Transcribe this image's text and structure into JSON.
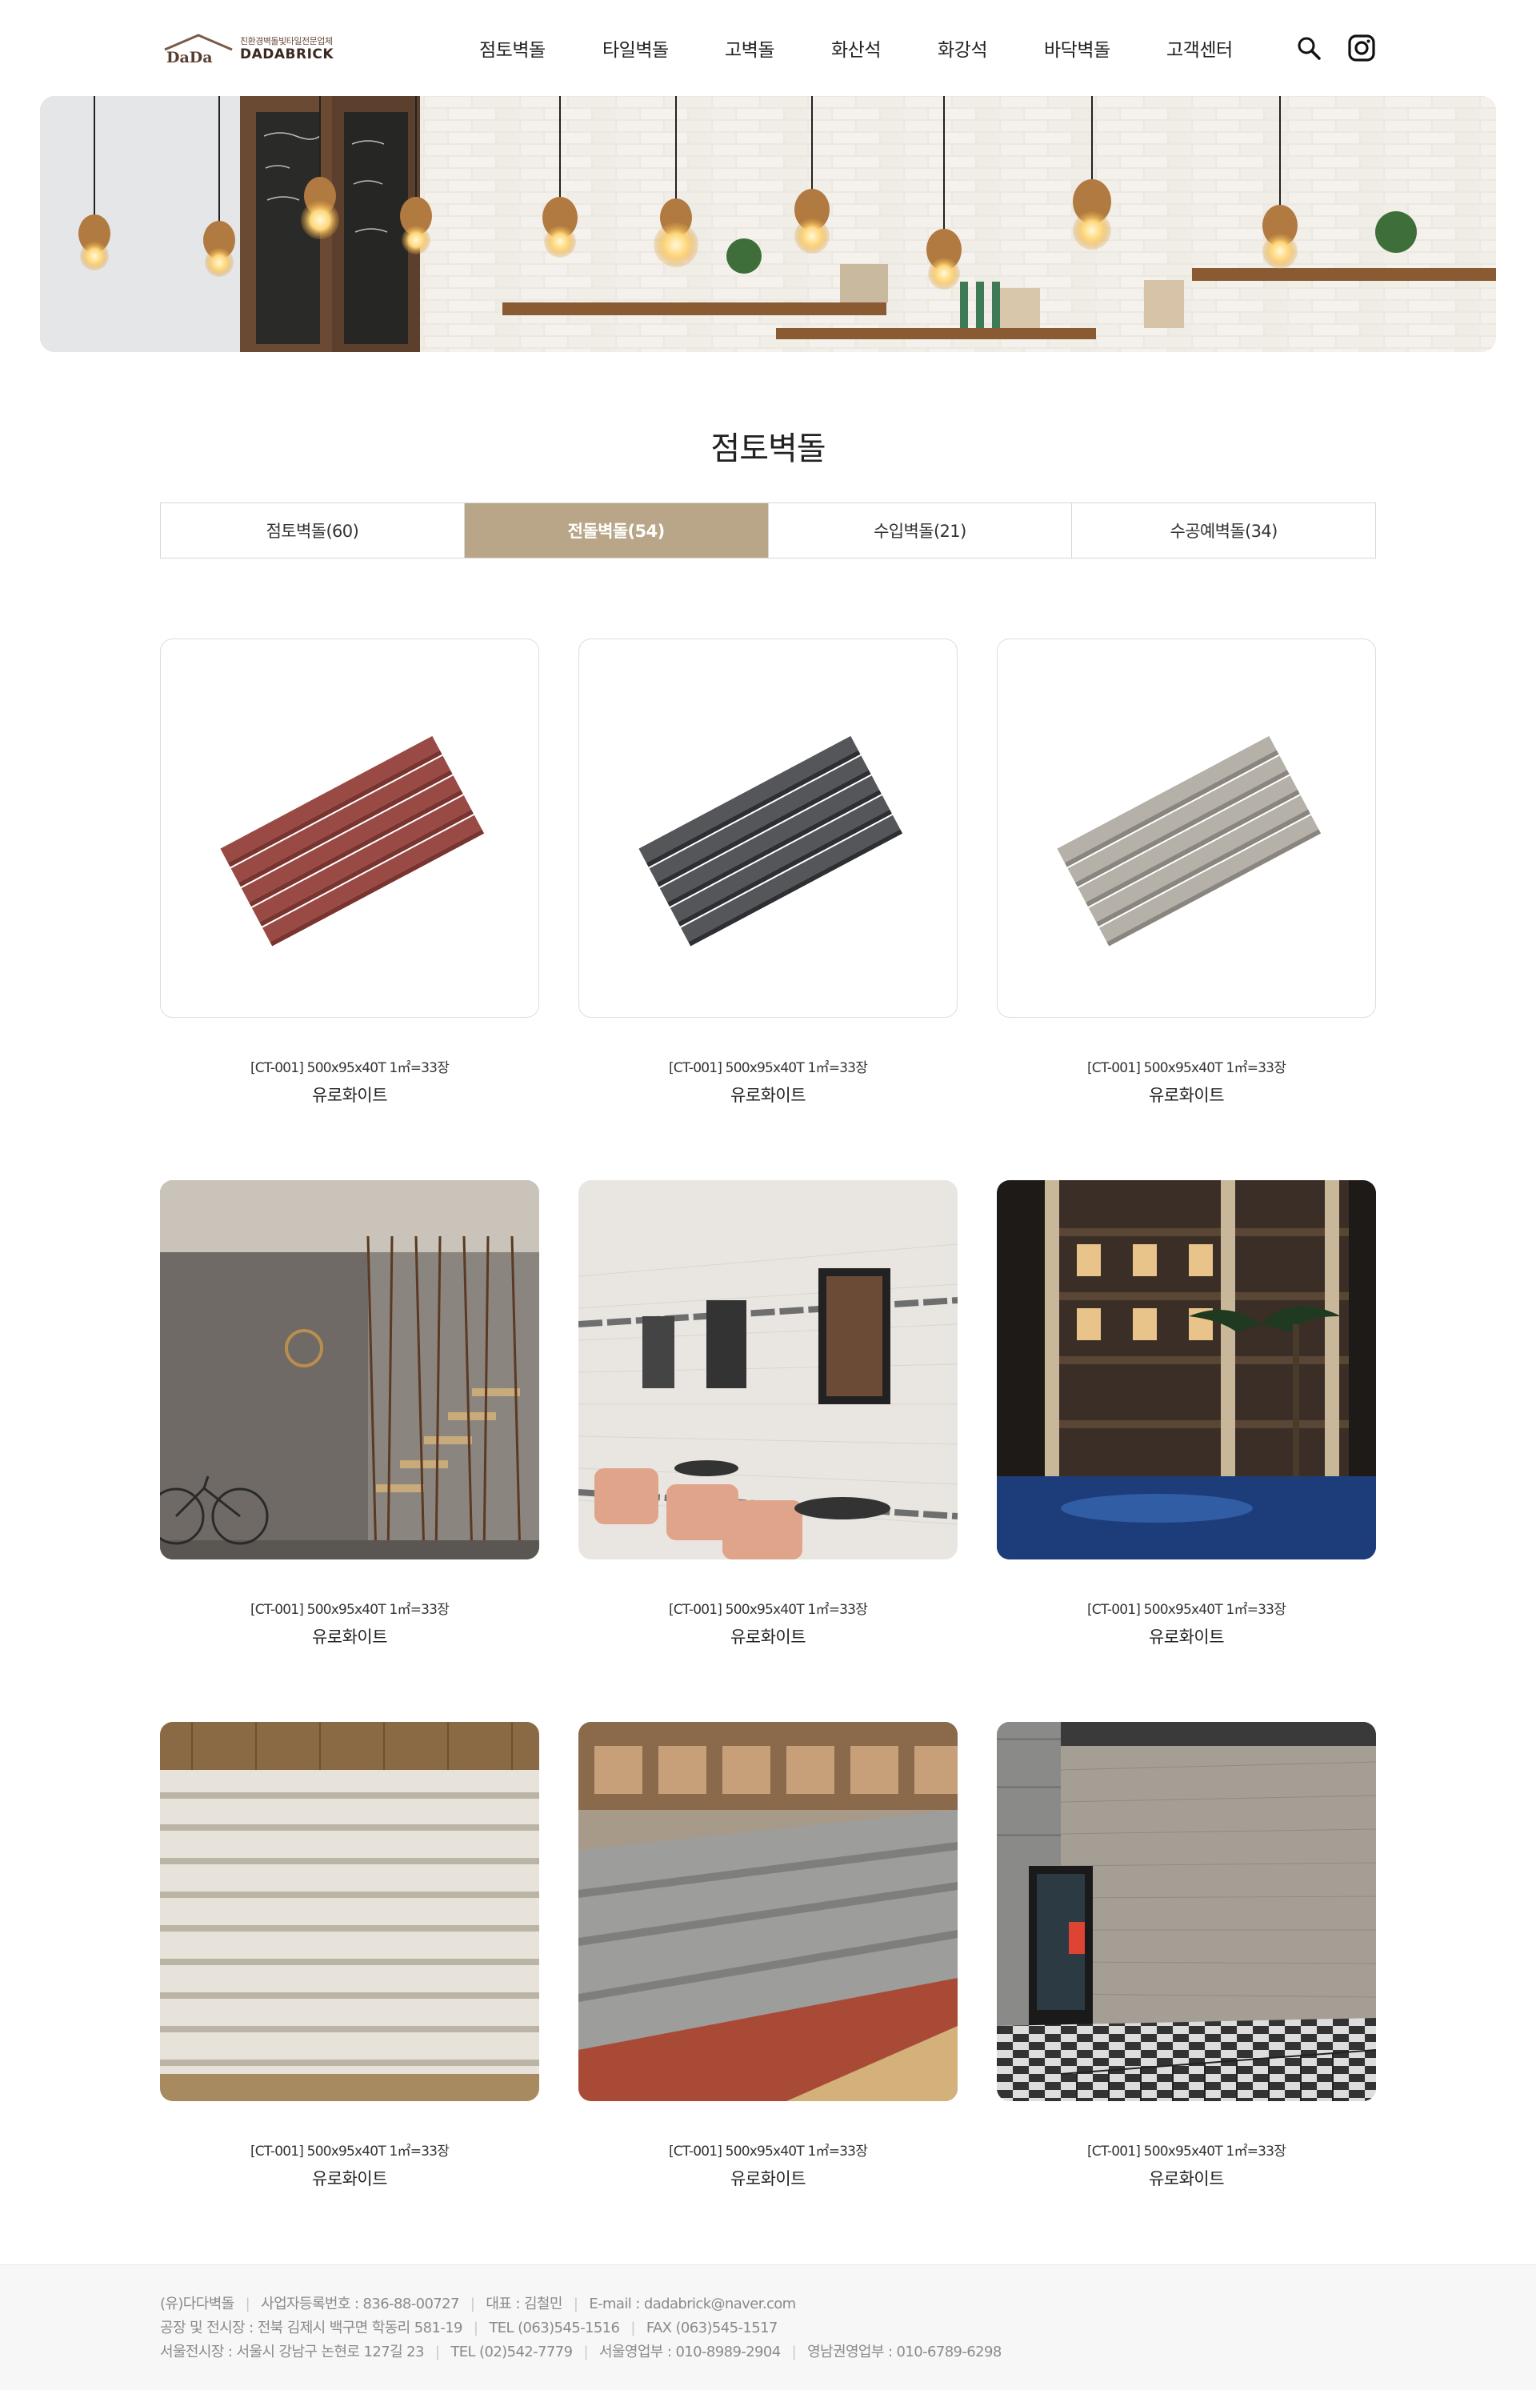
{
  "header": {
    "logo_mark": "DaDa",
    "logo_sub": "친환경벽돌빛타일전문업체",
    "logo_main": "DADABRICK",
    "nav": [
      "점토벽돌",
      "타일벽돌",
      "고벽돌",
      "화산석",
      "화강석",
      "바닥벽돌",
      "고객센터"
    ],
    "icons": [
      "search-icon",
      "instagram-icon"
    ]
  },
  "hero": {
    "icon": "cafe-interior-photo"
  },
  "section": {
    "title": "점토벽돌"
  },
  "tabs": [
    {
      "label": "점토벽돌(60)",
      "active": false
    },
    {
      "label": "전돌벽돌(54)",
      "active": true
    },
    {
      "label": "수입벽돌(21)",
      "active": false
    },
    {
      "label": "수공예벽돌(34)",
      "active": false
    }
  ],
  "products": [
    {
      "code": "[CT-001] 500x95x40T 1㎡=33장",
      "name": "유로화이트",
      "image": "red-brick-product"
    },
    {
      "code": "[CT-001] 500x95x40T 1㎡=33장",
      "name": "유로화이트",
      "image": "charcoal-brick-product"
    },
    {
      "code": "[CT-001] 500x95x40T 1㎡=33장",
      "name": "유로화이트",
      "image": "grey-brick-product"
    },
    {
      "code": "[CT-001] 500x95x40T 1㎡=33장",
      "name": "유로화이트",
      "image": "cafe-stair-photo"
    },
    {
      "code": "[CT-001] 500x95x40T 1㎡=33장",
      "name": "유로화이트",
      "image": "cafe-wall-photo"
    },
    {
      "code": "[CT-001] 500x95x40T 1㎡=33장",
      "name": "유로화이트",
      "image": "hotel-pool-photo"
    },
    {
      "code": "[CT-001] 500x95x40T 1㎡=33장",
      "name": "유로화이트",
      "image": "white-brick-wall-photo"
    },
    {
      "code": "[CT-001] 500x95x40T 1㎡=33장",
      "name": "유로화이트",
      "image": "brick-pallet-photo"
    },
    {
      "code": "[CT-001] 500x95x40T 1㎡=33장",
      "name": "유로화이트",
      "image": "building-facade-photo"
    }
  ],
  "footer": {
    "line1": [
      "(유)다다벽돌",
      "사업자등록번호 : 836-88-00727",
      "대표 : 김철민",
      "E-mail : dadabrick@naver.com"
    ],
    "line2": [
      "공장 및 전시장 : 전북 김제시 백구면 학동리 581-19",
      "TEL (063)545-1516",
      "FAX (063)545-1517"
    ],
    "line3": [
      "서울전시장 : 서울시 강남구 논현로 127길 23",
      "TEL (02)542-7779",
      "서울영업부 : 010-8989-2904",
      "영남권영업부 : 010-6789-6298"
    ]
  },
  "colors": {
    "accent": "#b9a688",
    "brand": "#5a3d2e",
    "text": "#222222"
  }
}
